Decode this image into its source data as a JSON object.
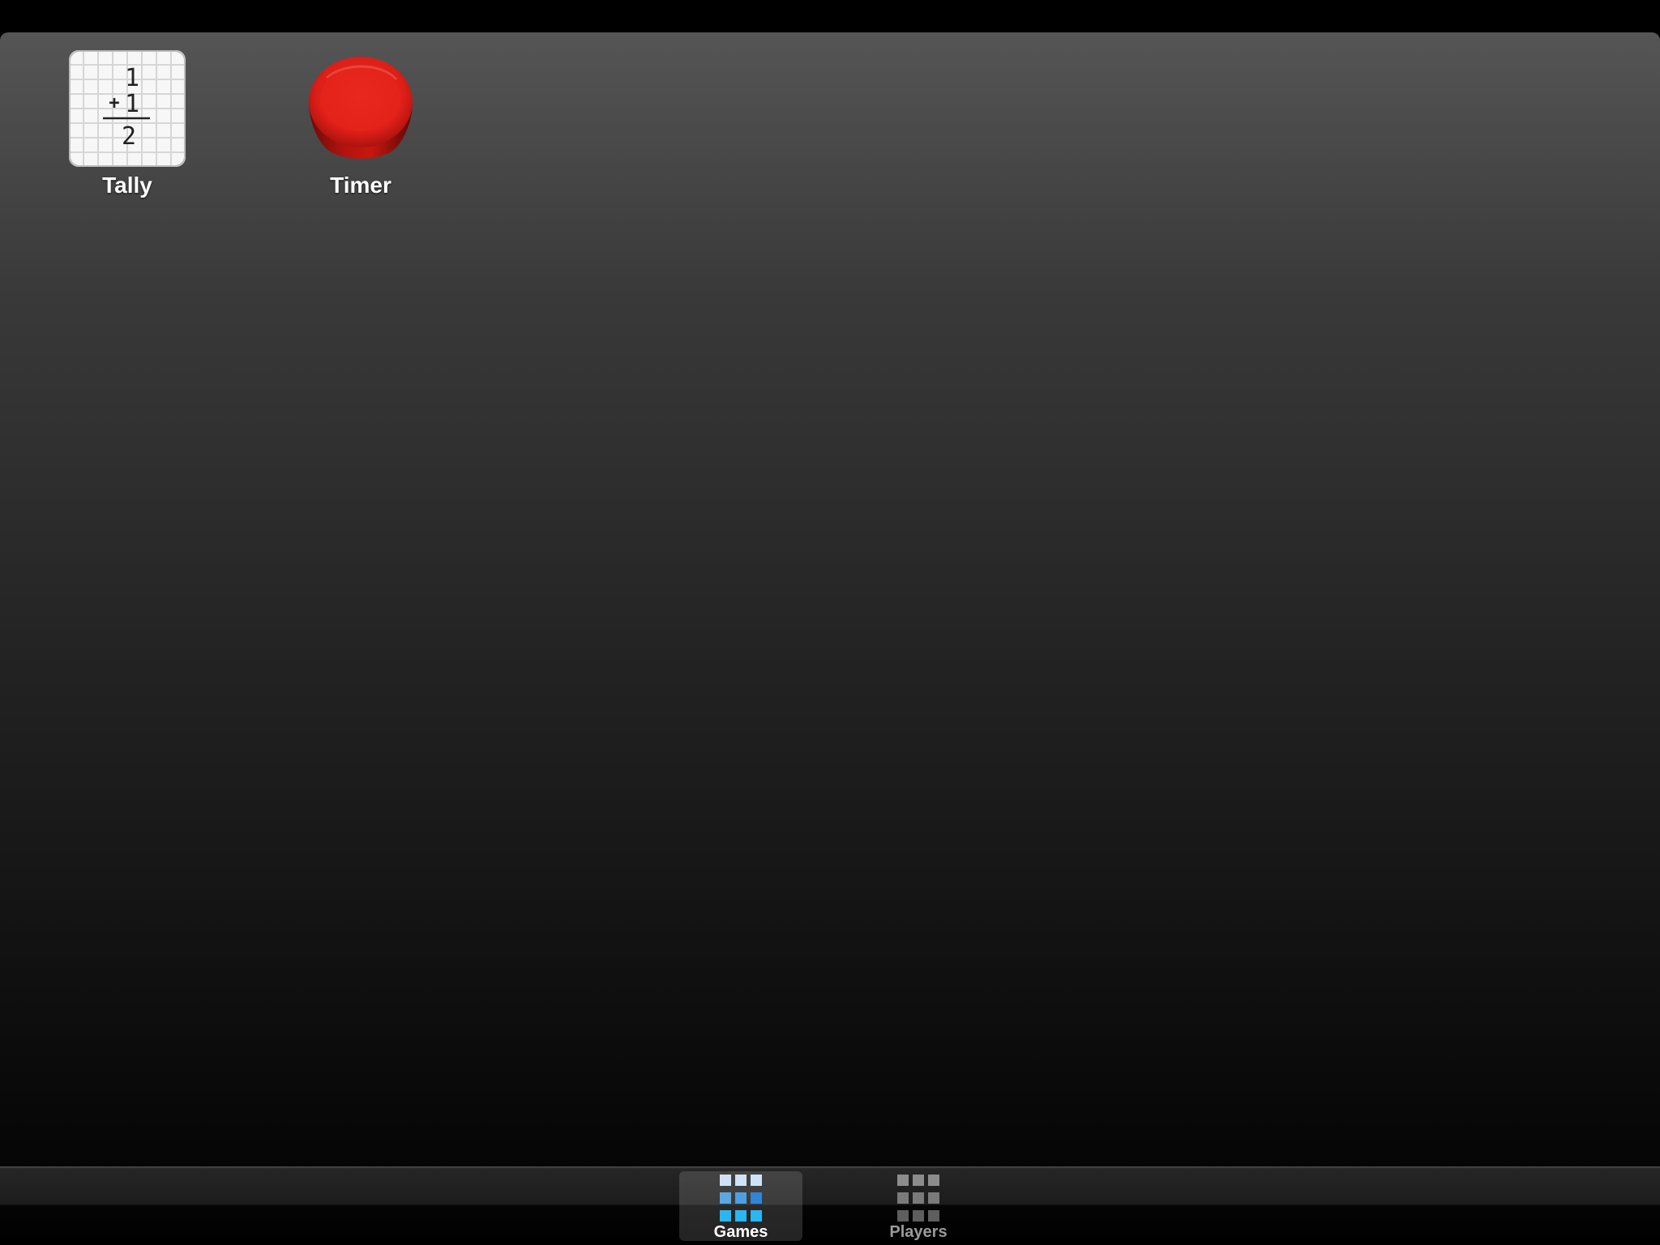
{
  "apps": [
    {
      "label": "Tally",
      "icon": "tally-sheet-icon",
      "digits": {
        "top": "1",
        "operator": "+",
        "middle": "1",
        "result": "2"
      }
    },
    {
      "label": "Timer",
      "icon": "red-button-icon"
    }
  ],
  "tab_bar": {
    "tabs": [
      {
        "label": "Games",
        "icon": "grid-icon",
        "selected": true
      },
      {
        "label": "Players",
        "icon": "grid-icon",
        "selected": false
      }
    ]
  },
  "colors": {
    "timer_red": "#e0261e",
    "selected_tab_icon": "#4fa6e6",
    "unselected_tab_icon": "#8a8a8a"
  }
}
